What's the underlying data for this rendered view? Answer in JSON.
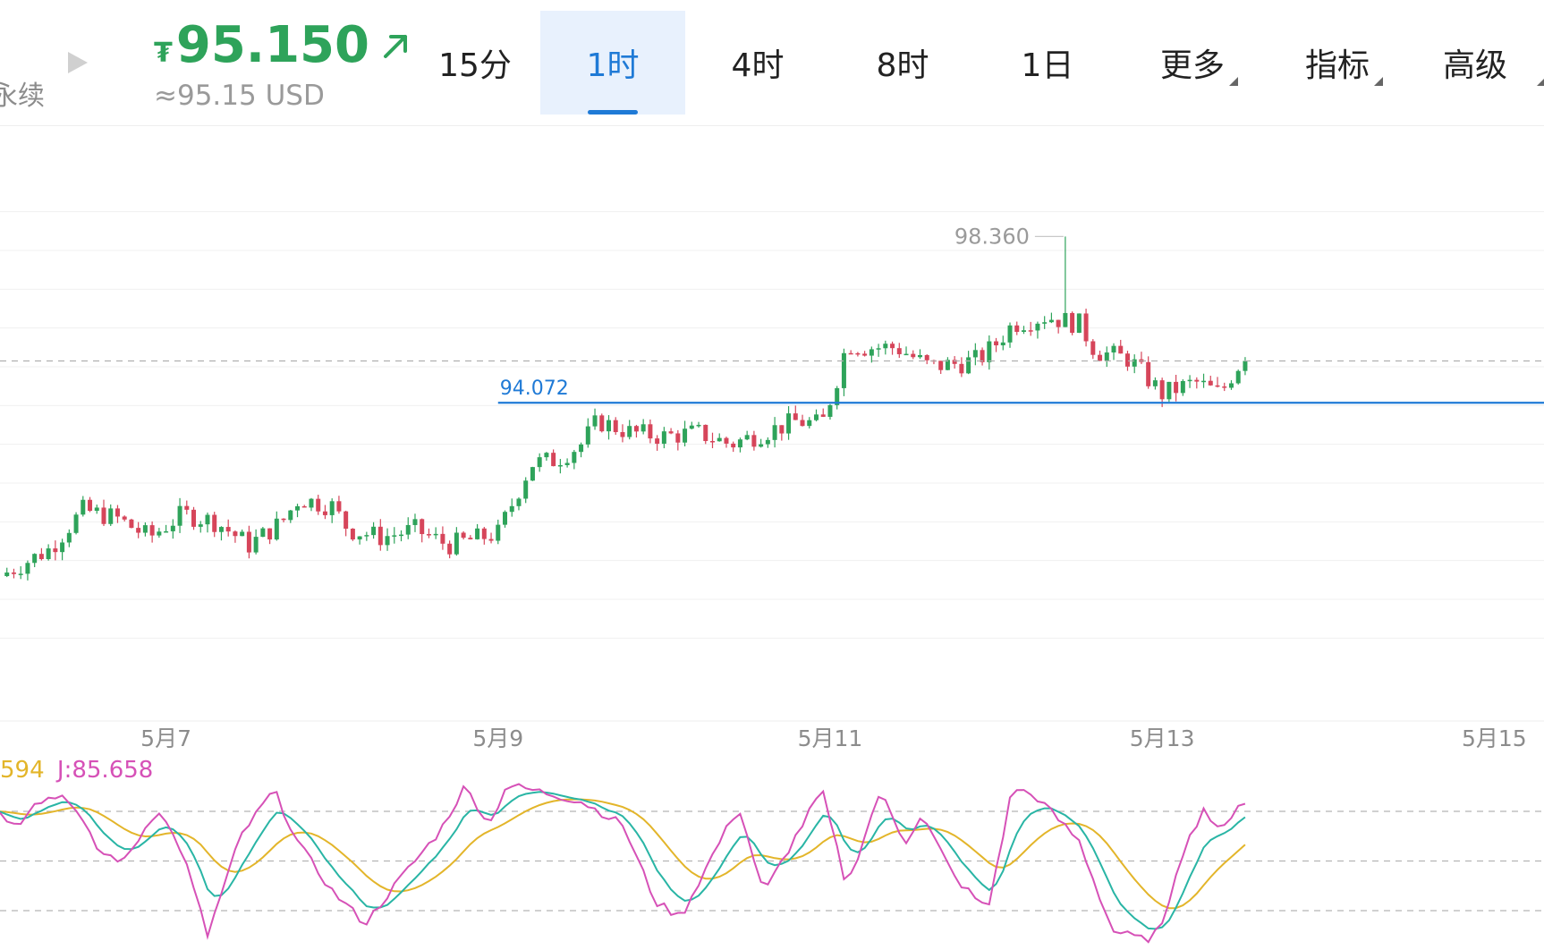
{
  "header": {
    "cut_label": "永续",
    "icons": {
      "play": "play-icon",
      "trend": "arrow-up-right-icon"
    },
    "currency_symbol": "₮",
    "price": "95.150",
    "usd_price": "≈95.15 USD",
    "tabs": [
      {
        "label": "15分",
        "active": false
      },
      {
        "label": "1时",
        "active": true
      },
      {
        "label": "4时",
        "active": false
      },
      {
        "label": "8时",
        "active": false
      },
      {
        "label": "1日",
        "active": false
      },
      {
        "label": "更多",
        "active": false,
        "dropdown": true
      },
      {
        "label": "指标",
        "active": false,
        "dropdown": true
      },
      {
        "label": "高级",
        "active": false,
        "dropdown": true
      }
    ]
  },
  "colors": {
    "up": "#2ea35a",
    "down": "#d6455a",
    "accent": "#1f7ad6",
    "k_line": "#29b5a5",
    "d_line": "#e3b52a",
    "j_line": "#d651b7"
  },
  "chart_data": {
    "type": "candlestick",
    "timeframe": "1时",
    "x_ticks": [
      "5月7",
      "5月9",
      "5月11",
      "5月13",
      "5月15"
    ],
    "x_tick_days": [
      7,
      9,
      11,
      13,
      15
    ],
    "x_range_days": [
      6.0,
      15.3
    ],
    "y_range": [
      86.0,
      101.0
    ],
    "gridlines_y": [
      99.0,
      98.0,
      97.0,
      96.0,
      95.0,
      94.0,
      93.0,
      92.0,
      91.0,
      90.0,
      89.0,
      88.0
    ],
    "high_label": "98.360",
    "high_value": 98.36,
    "horizontal_line_label": "94.072",
    "horizontal_line_value": 94.072,
    "current_price_value": 95.15,
    "close_anchors": [
      [
        6.0,
        89.6
      ],
      [
        6.3,
        90.3
      ],
      [
        6.5,
        91.3
      ],
      [
        6.7,
        91.1
      ],
      [
        6.9,
        90.6
      ],
      [
        7.1,
        91.2
      ],
      [
        7.3,
        91.0
      ],
      [
        7.5,
        90.4
      ],
      [
        7.7,
        91.0
      ],
      [
        7.8,
        91.6
      ],
      [
        8.0,
        91.4
      ],
      [
        8.1,
        90.8
      ],
      [
        8.3,
        90.6
      ],
      [
        8.5,
        90.8
      ],
      [
        8.7,
        90.4
      ],
      [
        8.9,
        90.6
      ],
      [
        9.0,
        90.7
      ],
      [
        9.1,
        91.6
      ],
      [
        9.2,
        92.5
      ],
      [
        9.35,
        92.6
      ],
      [
        9.5,
        93.0
      ],
      [
        9.6,
        93.6
      ],
      [
        9.8,
        93.3
      ],
      [
        10.0,
        93.2
      ],
      [
        10.2,
        93.3
      ],
      [
        10.4,
        93.0
      ],
      [
        10.6,
        93.3
      ],
      [
        10.8,
        93.6
      ],
      [
        10.95,
        93.5
      ],
      [
        11.05,
        94.8
      ],
      [
        11.1,
        95.6
      ],
      [
        11.2,
        95.5
      ],
      [
        11.4,
        95.5
      ],
      [
        11.6,
        95.0
      ],
      [
        11.8,
        95.1
      ],
      [
        11.9,
        95.2
      ],
      [
        12.0,
        95.6
      ],
      [
        12.1,
        96.1
      ],
      [
        12.3,
        96.3
      ],
      [
        12.5,
        96.1
      ],
      [
        12.6,
        95.4
      ],
      [
        12.8,
        95.2
      ],
      [
        13.0,
        94.3
      ],
      [
        13.2,
        94.6
      ],
      [
        13.35,
        94.3
      ],
      [
        13.45,
        95.0
      ],
      [
        13.5,
        95.2
      ]
    ],
    "kdj": {
      "levels": [
        80,
        50,
        20
      ],
      "y_range": [
        0,
        100
      ],
      "j_last": "85.658",
      "d_last_partial": "594",
      "j_anchors": [
        [
          6.0,
          80
        ],
        [
          6.1,
          70
        ],
        [
          6.2,
          86
        ],
        [
          6.4,
          90
        ],
        [
          6.6,
          55
        ],
        [
          6.75,
          50
        ],
        [
          6.95,
          82
        ],
        [
          7.1,
          55
        ],
        [
          7.25,
          5
        ],
        [
          7.45,
          65
        ],
        [
          7.65,
          93
        ],
        [
          7.8,
          60
        ],
        [
          8.0,
          32
        ],
        [
          8.2,
          12
        ],
        [
          8.4,
          38
        ],
        [
          8.65,
          68
        ],
        [
          8.8,
          95
        ],
        [
          8.95,
          72
        ],
        [
          9.05,
          96
        ],
        [
          9.25,
          92
        ],
        [
          9.5,
          86
        ],
        [
          9.75,
          72
        ],
        [
          9.95,
          25
        ],
        [
          10.1,
          16
        ],
        [
          10.3,
          55
        ],
        [
          10.45,
          83
        ],
        [
          10.6,
          30
        ],
        [
          10.8,
          66
        ],
        [
          10.95,
          93
        ],
        [
          11.1,
          34
        ],
        [
          11.3,
          92
        ],
        [
          11.45,
          61
        ],
        [
          11.55,
          78
        ],
        [
          11.75,
          40
        ],
        [
          11.95,
          20
        ],
        [
          12.1,
          95
        ],
        [
          12.25,
          88
        ],
        [
          12.5,
          62
        ],
        [
          12.7,
          8
        ],
        [
          12.9,
          2
        ],
        [
          13.0,
          10
        ],
        [
          13.1,
          50
        ],
        [
          13.25,
          82
        ],
        [
          13.35,
          66
        ],
        [
          13.45,
          84
        ],
        [
          13.5,
          85.658
        ]
      ]
    }
  }
}
